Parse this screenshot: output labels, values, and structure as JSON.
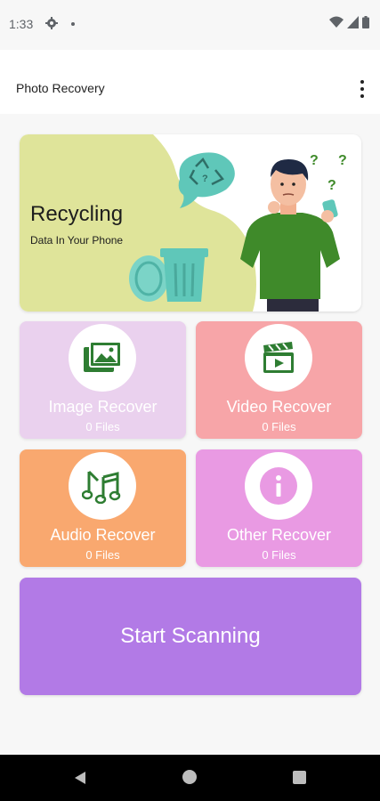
{
  "status": {
    "time": "1:33",
    "icons": [
      "gear-icon",
      "notification-dot",
      "wifi-icon",
      "signal-icon",
      "battery-icon"
    ]
  },
  "app_bar": {
    "title": "Photo Recovery",
    "menu_icon": "more-vert-icon"
  },
  "banner": {
    "title": "Recycling",
    "subtitle": "Data In Your Phone",
    "colors": {
      "green_shape": "#dfe49a",
      "accent": "#5fc7b9",
      "shirt": "#3f8a2a"
    }
  },
  "tiles": [
    {
      "label": "Image Recover",
      "count": "0 Files",
      "icon": "image-icon",
      "color": "#ead1ee"
    },
    {
      "label": "Video Recover",
      "count": "0 Files",
      "icon": "clapperboard-icon",
      "color": "#f7a5a8"
    },
    {
      "label": "Audio Recover",
      "count": "0 Files",
      "icon": "music-note-icon",
      "color": "#f9a86f"
    },
    {
      "label": "Other Recover",
      "count": "0 Files",
      "icon": "info-icon",
      "color": "#e99ae3"
    }
  ],
  "start_button": {
    "label": "Start Scanning",
    "color": "#b27ae6"
  },
  "nav": {
    "icons": [
      "back-icon",
      "home-icon",
      "recents-icon"
    ]
  }
}
